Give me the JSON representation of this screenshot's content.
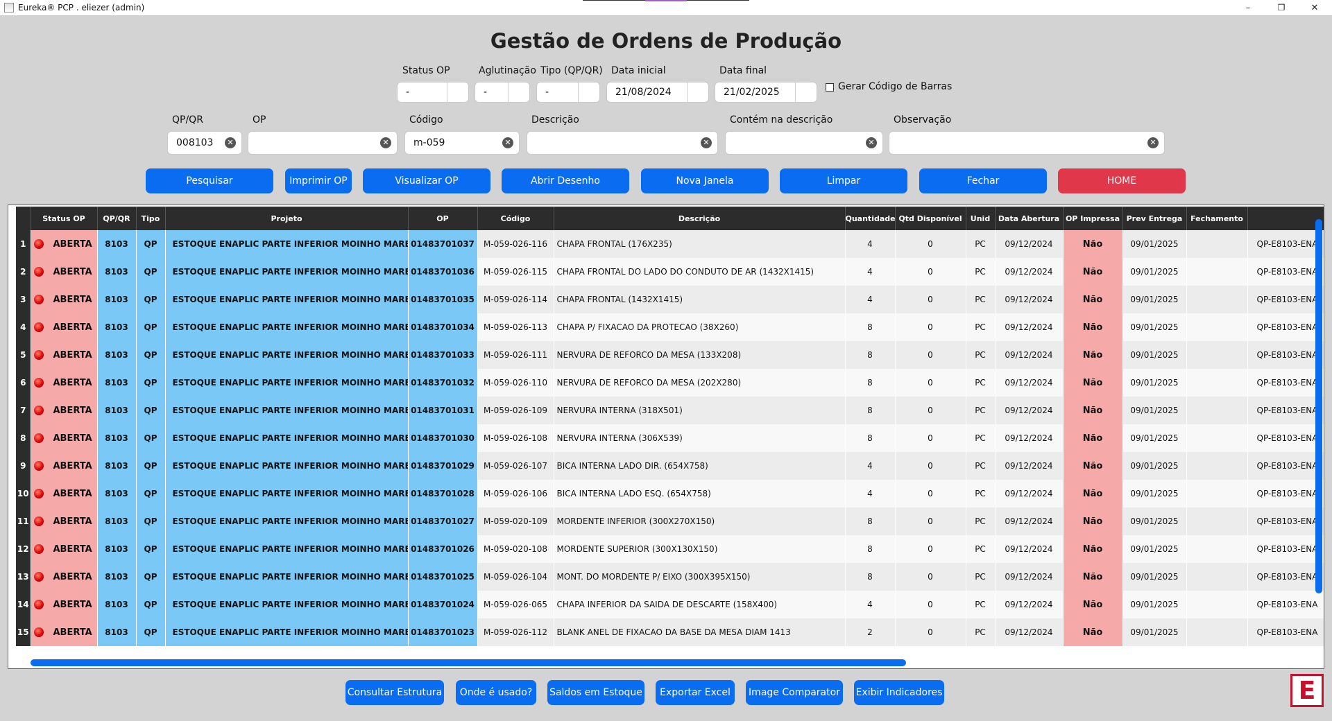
{
  "window": {
    "title": "Eureka® PCP . eliezer (admin)",
    "minimize": "–",
    "maximize": "❐",
    "close": "✕"
  },
  "page_title": "Gestão de Ordens de Produção",
  "filters_top": {
    "status_op": {
      "label": "Status OP",
      "value": "-"
    },
    "aglutinacao": {
      "label": "Aglutinação",
      "value": "-"
    },
    "tipo": {
      "label": "Tipo (QP/QR)",
      "value": "-"
    },
    "data_inicial": {
      "label": "Data inicial",
      "value": "21/08/2024"
    },
    "data_final": {
      "label": "Data final",
      "value": "21/02/2025"
    },
    "barcode": {
      "label": "Gerar Código de Barras",
      "checked": false
    }
  },
  "filters_search": {
    "qpqr": {
      "label": "QP/QR",
      "value": "008103"
    },
    "op": {
      "label": "OP",
      "value": ""
    },
    "codigo": {
      "label": "Código",
      "value": "m-059"
    },
    "descricao": {
      "label": "Descrição",
      "value": ""
    },
    "contem": {
      "label": "Contém na descrição",
      "value": ""
    },
    "observacao": {
      "label": "Observação",
      "value": ""
    }
  },
  "actions": {
    "pesquisar": "Pesquisar",
    "imprimir": "Imprimir OP",
    "visualizar": "Visualizar OP",
    "abrir_desenho": "Abrir Desenho",
    "nova_janela": "Nova Janela",
    "limpar": "Limpar",
    "fechar": "Fechar",
    "home": "HOME"
  },
  "table": {
    "columns": [
      "Status OP",
      "QP/QR",
      "Tipo",
      "Projeto",
      "OP",
      "Código",
      "Descrição",
      "Quantidade",
      "Qtd Disponível",
      "Unid",
      "Data Abertura",
      "OP Impressa",
      "Prev Entrega",
      "Fechamento",
      ""
    ],
    "rows": [
      [
        "1",
        "ABERTA",
        "8103",
        "QP",
        "ESTOQUE ENAPLIC  PARTE INFERIOR MOINHO MARE",
        "01483701037",
        "M-059-026-116",
        "CHAPA FRONTAL (176X235)",
        "4",
        "0",
        "PC",
        "09/12/2024",
        "Não",
        "09/01/2025",
        "",
        "QP-E8103-ENA"
      ],
      [
        "2",
        "ABERTA",
        "8103",
        "QP",
        "ESTOQUE ENAPLIC  PARTE INFERIOR MOINHO MARE",
        "01483701036",
        "M-059-026-115",
        "CHAPA FRONTAL DO LADO DO CONDUTO DE AR (1432X1415)",
        "4",
        "0",
        "PC",
        "09/12/2024",
        "Não",
        "09/01/2025",
        "",
        "QP-E8103-ENA"
      ],
      [
        "3",
        "ABERTA",
        "8103",
        "QP",
        "ESTOQUE ENAPLIC  PARTE INFERIOR MOINHO MARE",
        "01483701035",
        "M-059-026-114",
        "CHAPA FRONTAL (1432X1415)",
        "4",
        "0",
        "PC",
        "09/12/2024",
        "Não",
        "09/01/2025",
        "",
        "QP-E8103-ENA"
      ],
      [
        "4",
        "ABERTA",
        "8103",
        "QP",
        "ESTOQUE ENAPLIC  PARTE INFERIOR MOINHO MARE",
        "01483701034",
        "M-059-026-113",
        "CHAPA P/ FIXACAO DA PROTECAO (38X260)",
        "8",
        "0",
        "PC",
        "09/12/2024",
        "Não",
        "09/01/2025",
        "",
        "QP-E8103-ENA"
      ],
      [
        "5",
        "ABERTA",
        "8103",
        "QP",
        "ESTOQUE ENAPLIC  PARTE INFERIOR MOINHO MARE",
        "01483701033",
        "M-059-026-111",
        "NERVURA DE REFORCO DA MESA (133X208)",
        "8",
        "0",
        "PC",
        "09/12/2024",
        "Não",
        "09/01/2025",
        "",
        "QP-E8103-ENA"
      ],
      [
        "6",
        "ABERTA",
        "8103",
        "QP",
        "ESTOQUE ENAPLIC  PARTE INFERIOR MOINHO MARE",
        "01483701032",
        "M-059-026-110",
        "NERVURA DE REFORCO DA MESA (202X280)",
        "8",
        "0",
        "PC",
        "09/12/2024",
        "Não",
        "09/01/2025",
        "",
        "QP-E8103-ENA"
      ],
      [
        "7",
        "ABERTA",
        "8103",
        "QP",
        "ESTOQUE ENAPLIC  PARTE INFERIOR MOINHO MARE",
        "01483701031",
        "M-059-026-109",
        "NERVURA INTERNA (318X501)",
        "8",
        "0",
        "PC",
        "09/12/2024",
        "Não",
        "09/01/2025",
        "",
        "QP-E8103-ENA"
      ],
      [
        "8",
        "ABERTA",
        "8103",
        "QP",
        "ESTOQUE ENAPLIC  PARTE INFERIOR MOINHO MARE",
        "01483701030",
        "M-059-026-108",
        "NERVURA INTERNA (306X539)",
        "8",
        "0",
        "PC",
        "09/12/2024",
        "Não",
        "09/01/2025",
        "",
        "QP-E8103-ENA"
      ],
      [
        "9",
        "ABERTA",
        "8103",
        "QP",
        "ESTOQUE ENAPLIC  PARTE INFERIOR MOINHO MARE",
        "01483701029",
        "M-059-026-107",
        "BICA INTERNA LADO DIR. (654X758)",
        "4",
        "0",
        "PC",
        "09/12/2024",
        "Não",
        "09/01/2025",
        "",
        "QP-E8103-ENA"
      ],
      [
        "10",
        "ABERTA",
        "8103",
        "QP",
        "ESTOQUE ENAPLIC  PARTE INFERIOR MOINHO MARE",
        "01483701028",
        "M-059-026-106",
        "BICA INTERNA LADO ESQ. (654X758)",
        "4",
        "0",
        "PC",
        "09/12/2024",
        "Não",
        "09/01/2025",
        "",
        "QP-E8103-ENA"
      ],
      [
        "11",
        "ABERTA",
        "8103",
        "QP",
        "ESTOQUE ENAPLIC  PARTE INFERIOR MOINHO MARE",
        "01483701027",
        "M-059-020-109",
        "MORDENTE INFERIOR (300X270X150)",
        "8",
        "0",
        "PC",
        "09/12/2024",
        "Não",
        "09/01/2025",
        "",
        "QP-E8103-ENA"
      ],
      [
        "12",
        "ABERTA",
        "8103",
        "QP",
        "ESTOQUE ENAPLIC  PARTE INFERIOR MOINHO MARE",
        "01483701026",
        "M-059-020-108",
        "MORDENTE SUPERIOR (300X130X150)",
        "8",
        "0",
        "PC",
        "09/12/2024",
        "Não",
        "09/01/2025",
        "",
        "QP-E8103-ENA"
      ],
      [
        "13",
        "ABERTA",
        "8103",
        "QP",
        "ESTOQUE ENAPLIC  PARTE INFERIOR MOINHO MARE",
        "01483701025",
        "M-059-026-104",
        "MONT. DO MORDENTE P/ EIXO (300X395X150)",
        "8",
        "0",
        "PC",
        "09/12/2024",
        "Não",
        "09/01/2025",
        "",
        "QP-E8103-ENA"
      ],
      [
        "14",
        "ABERTA",
        "8103",
        "QP",
        "ESTOQUE ENAPLIC  PARTE INFERIOR MOINHO MARE",
        "01483701024",
        "M-059-026-065",
        "CHAPA INFERIOR DA SAIDA DE DESCARTE (158X400)",
        "4",
        "0",
        "PC",
        "09/12/2024",
        "Não",
        "09/01/2025",
        "",
        "QP-E8103-ENA"
      ],
      [
        "15",
        "ABERTA",
        "8103",
        "QP",
        "ESTOQUE ENAPLIC  PARTE INFERIOR MOINHO MARE",
        "01483701023",
        "M-059-026-112",
        "BLANK ANEL DE FIXACAO DA BASE DA MESA DIAM 1413",
        "2",
        "0",
        "PC",
        "09/12/2024",
        "Não",
        "09/01/2025",
        "",
        "QP-E8103-ENA"
      ]
    ]
  },
  "bottom_actions": {
    "consultar": "Consultar Estrutura",
    "onde": "Onde é usado?",
    "saldos": "Saldos em Estoque",
    "exportar": "Exportar Excel",
    "image_comparator": "Image Comparator",
    "indicadores": "Exibir Indicadores"
  },
  "logo_letter": "E",
  "colors": {
    "primary": "#0a6cf0",
    "danger": "#e0384a",
    "status_bg": "#f5a9a9",
    "id_bg": "#79c8f5",
    "header_bg": "#2c2c2c"
  }
}
